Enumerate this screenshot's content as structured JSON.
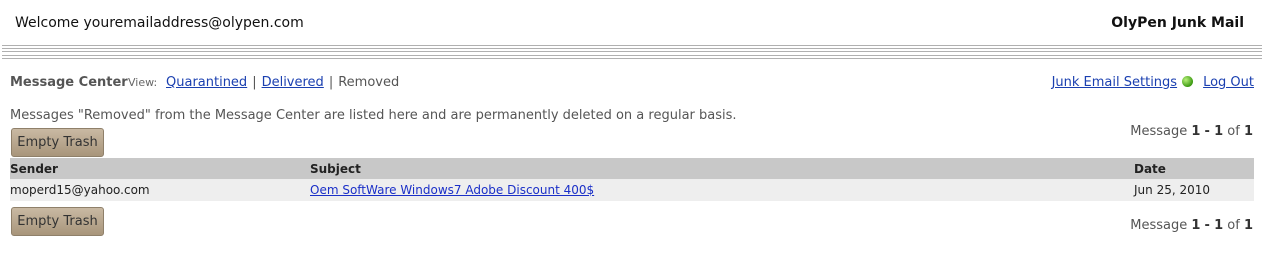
{
  "header": {
    "welcome": "Welcome youremailaddress@olypen.com",
    "brand": "OlyPen Junk Mail"
  },
  "toolbar": {
    "title": "Message Center",
    "view_label": "View:",
    "views": {
      "quarantined": "Quarantined",
      "delivered": "Delivered",
      "removed": "Removed",
      "separator": "|"
    },
    "settings": "Junk Email Settings",
    "status_color": "#3c9a12",
    "logout": "Log Out"
  },
  "note": "Messages \"Removed\" from the Message Center are listed here and are permanently deleted on a regular basis.",
  "buttons": {
    "empty_trash": "Empty Trash"
  },
  "pager": {
    "prefix": "Message",
    "start": "1",
    "dash": "-",
    "end": "1",
    "of": "of",
    "total": "1"
  },
  "table": {
    "columns": {
      "sender": "Sender",
      "subject": "Subject",
      "date": "Date"
    },
    "rows": [
      {
        "sender": "moperd15@yahoo.com",
        "subject": "Oem SoftWare Windows7 Adobe Discount 400$",
        "date": "Jun 25, 2010"
      }
    ]
  }
}
